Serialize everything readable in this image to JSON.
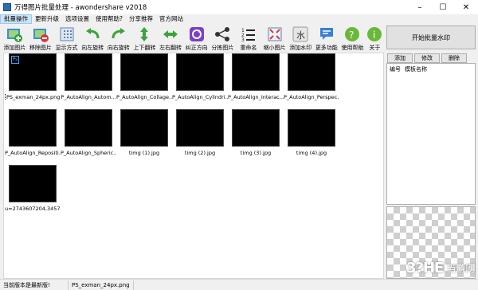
{
  "window": {
    "title": "万得图片批量处理 - awondershare v2018",
    "minimize": "–",
    "maximize": "☐",
    "close": "✕"
  },
  "menu": [
    "批量操作",
    "更新升级",
    "选项设置",
    "使用帮助?",
    "分享推荐",
    "官方网站"
  ],
  "toolbar": [
    {
      "label": "添加图片",
      "icon": "add-image-icon"
    },
    {
      "label": "移除图片",
      "icon": "remove-image-icon"
    },
    {
      "label": "显示方式",
      "icon": "view-mode-icon"
    },
    {
      "label": "向左旋转",
      "icon": "rotate-left-icon"
    },
    {
      "label": "向右旋转",
      "icon": "rotate-right-icon"
    },
    {
      "label": "上下翻转",
      "icon": "flip-vertical-icon"
    },
    {
      "label": "左右翻转",
      "icon": "flip-horizontal-icon"
    },
    {
      "label": "纠正方向",
      "icon": "correct-orientation-icon"
    },
    {
      "label": "分拣图片",
      "icon": "share-sort-icon"
    },
    {
      "label": "重命名",
      "icon": "rename-icon"
    },
    {
      "label": "缩小图片",
      "icon": "shrink-icon"
    },
    {
      "label": "添加水印",
      "icon": "watermark-icon"
    },
    {
      "label": "更多功能",
      "icon": "more-icon"
    },
    {
      "label": "使用帮助",
      "icon": "help-icon"
    },
    {
      "label": "关于",
      "icon": "info-icon"
    }
  ],
  "images": [
    {
      "caption": "PS_exman_24px.png",
      "style": "ps",
      "selected": true
    },
    {
      "caption": "P_AutoAlign_Autom...",
      "style": "house"
    },
    {
      "caption": "P_AutoAlign_Collage...",
      "style": "house"
    },
    {
      "caption": "P_AutoAlign_Cylindri...",
      "style": "house"
    },
    {
      "caption": "P_AutoAlign_Interac...",
      "style": "house"
    },
    {
      "caption": "P_AutoAlign_Perspec...",
      "style": "house"
    },
    {
      "caption": "P_AutoAlign_Repositi...",
      "style": "house"
    },
    {
      "caption": "P_AutoAlign_Spheric...",
      "style": "house"
    },
    {
      "caption": "timg (1).jpg",
      "style": "night"
    },
    {
      "caption": "timg (2).jpg",
      "style": "moon1"
    },
    {
      "caption": "timg (3).jpg",
      "style": "deer1"
    },
    {
      "caption": "timg (4).jpg",
      "style": "storm"
    },
    {
      "caption": "u=2743607204,3457...",
      "style": "deer2"
    }
  ],
  "right_panel": {
    "start_button": "开始批量水印",
    "tabs": [
      "添加",
      "修改",
      "删除"
    ],
    "columns": [
      "编号",
      "模板名称"
    ]
  },
  "status": {
    "left": "当前版本是最新版!",
    "file": "PS_exman_24px.png"
  },
  "watermark": {
    "logo": "3?HE",
    "text": "当游网"
  }
}
